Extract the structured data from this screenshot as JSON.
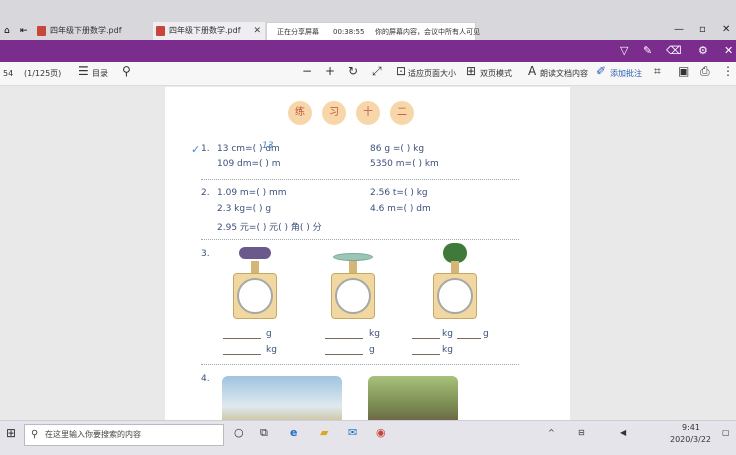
{
  "tabs": [
    {
      "label": "四年级下册数学.pdf",
      "active": false
    },
    {
      "label": "四年级下册数学.pdf",
      "active": true
    }
  ],
  "sharebar": {
    "status": "正在分享屏幕",
    "time": "00:38:55",
    "message": "你的屏幕内容，会议中所有人可见"
  },
  "toolbar": {
    "page_current": "54",
    "page_total": "(1/125页)",
    "toc_label": "目录",
    "fit_width_label": "适应页面大小",
    "view_mode_label": "双页模式",
    "read_aloud_label": "朗读文档内容",
    "notes_label": "添加批注"
  },
  "document": {
    "title_chars": [
      "练",
      "习",
      "十",
      "二"
    ],
    "q1": {
      "num": "1.",
      "a": "13 cm=(  ) dm",
      "b": "109 dm=(    ) m",
      "c": "86 g =(     ) kg",
      "d": "5350 m=(     ) km",
      "handwritten": "13"
    },
    "q2": {
      "num": "2.",
      "a": "1.09 m=(     ) mm",
      "b": "2.3 kg=(     ) g",
      "c": "2.95 元=(     ) 元(     ) 角(     ) 分",
      "d": "2.56 t=(     ) kg",
      "e": "4.6 m=(     ) dm"
    },
    "q3": {
      "num": "3.",
      "unit_g": "g",
      "unit_kg": "kg"
    },
    "q4": {
      "num": "4."
    }
  },
  "taskbar": {
    "search_placeholder": "在这里输入你要搜索的内容",
    "time": "9:41",
    "date": "2020/3/22"
  },
  "colors": {
    "ribbon": "#7a2d8c",
    "accent_text": "#3c4f7a",
    "title_badge": "#f7d7a9"
  }
}
